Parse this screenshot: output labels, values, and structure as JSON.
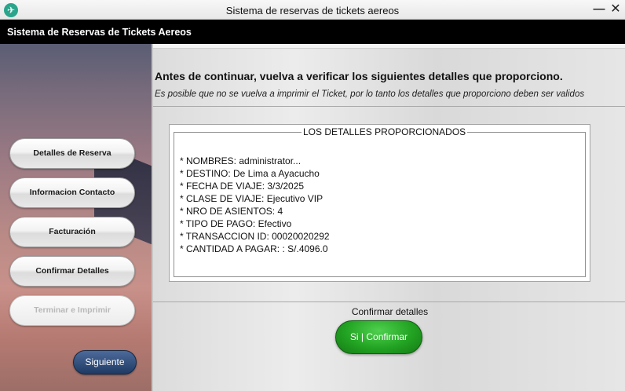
{
  "window": {
    "title": "Sistema de reservas de tickets aereos",
    "icon": "airplane-icon",
    "minimize_glyph": "—",
    "close_glyph": "✕"
  },
  "header": {
    "title": "Sistema de Reservas de Tickets Aereos"
  },
  "sidebar": {
    "items": [
      {
        "label": "Detalles de Reserva",
        "enabled": true
      },
      {
        "label": "Informacion Contacto",
        "enabled": true
      },
      {
        "label": "Facturación",
        "enabled": true
      },
      {
        "label": "Confirmar Detalles",
        "enabled": true
      },
      {
        "label": "Terminar e Imprimir",
        "enabled": false
      }
    ],
    "next_label": "Siguiente"
  },
  "main": {
    "heading": "Antes de continuar, vuelva a verificar los siguientes detalles que proporciono.",
    "subheading": "Es posible que no se vuelva a imprimir el Ticket, por lo tanto los detalles que proporciono deben ser validos",
    "details": {
      "legend": "LOS DETALLES PROPORCIONADOS",
      "lines": [
        "* NOMBRES: administrator...",
        "* DESTINO: De Lima a Ayacucho",
        "* FECHA DE VIAJE: 3/3/2025",
        "* CLASE DE VIAJE: Ejecutivo VIP",
        "* NRO DE ASIENTOS: 4",
        "* TIPO DE PAGO: Efectivo",
        "* TRANSACCION ID: 00020020292",
        "* CANTIDAD A PAGAR: : S/.4096.0"
      ]
    },
    "confirm_label": "Confirmar detalles",
    "confirm_button": "Si | Confirmar"
  },
  "colors": {
    "header_bg": "#000000",
    "confirm_green": "#22a322",
    "next_blue": "#1e3a64"
  }
}
